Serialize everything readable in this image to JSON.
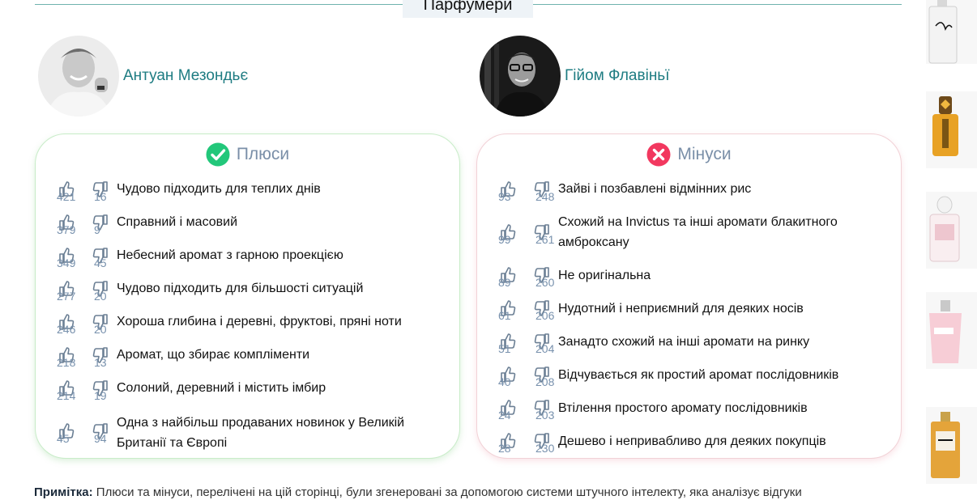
{
  "section": {
    "title": "Парфумери"
  },
  "perfumers": [
    {
      "name": "Антуан Мезондьє"
    },
    {
      "name": "Гійом Флавіньї"
    }
  ],
  "pros": {
    "title": "Плюси",
    "items": [
      {
        "text": "Чудово підходить для теплих днів",
        "up": "421",
        "down": "16"
      },
      {
        "text": "Справний і масовий",
        "up": "379",
        "down": "9"
      },
      {
        "text": "Небесний аромат з гарною проекцією",
        "up": "349",
        "down": "45"
      },
      {
        "text": "Чудово підходить для більшості ситуацій",
        "up": "277",
        "down": "20"
      },
      {
        "text": "Хороша глибина і деревні, фруктові, пряні ноти",
        "up": "246",
        "down": "20"
      },
      {
        "text": "Аромат, що збирає компліменти",
        "up": "218",
        "down": "13"
      },
      {
        "text": "Солоний, деревний і містить імбир",
        "up": "214",
        "down": "19"
      },
      {
        "text": "Одна з найбільш продаваних новинок у Великій Британії та Європі",
        "up": "45",
        "down": "94"
      }
    ]
  },
  "cons": {
    "title": "Мінуси",
    "items": [
      {
        "text": "Зайві і позбавлені відмінних рис",
        "up": "93",
        "down": "248"
      },
      {
        "text": "Схожий на Invictus та інші аромати блакитного амброксану",
        "up": "99",
        "down": "261"
      },
      {
        "text": "Не оригінальна",
        "up": "89",
        "down": "260"
      },
      {
        "text": "Нудотний і неприємний для деяких носів",
        "up": "61",
        "down": "206"
      },
      {
        "text": "Занадто схожий на інші аромати на ринку",
        "up": "51",
        "down": "204"
      },
      {
        "text": "Відчувається як простий аромат послідовників",
        "up": "40",
        "down": "208"
      },
      {
        "text": "Втілення простого аромату послідовників",
        "up": "24",
        "down": "203"
      },
      {
        "text": "Дешево і непривабливо для деяких покупців",
        "up": "28",
        "down": "230"
      }
    ]
  },
  "note": {
    "label": "Примітка:",
    "text": "Плюси та мінуси, перелічені на цій сторінці, були згенеровані за допомогою системи штучного інтелекту, яка аналізує відгуки"
  },
  "colors": {
    "accent": "#1e7c82",
    "pros_icon": "#22c77a",
    "cons_icon": "#f2385f",
    "vote_count": "#7891ad"
  },
  "icons": {
    "pros": "check-circle-icon",
    "cons": "x-circle-icon",
    "up": "thumbs-up-icon",
    "down": "thumbs-down-icon"
  }
}
